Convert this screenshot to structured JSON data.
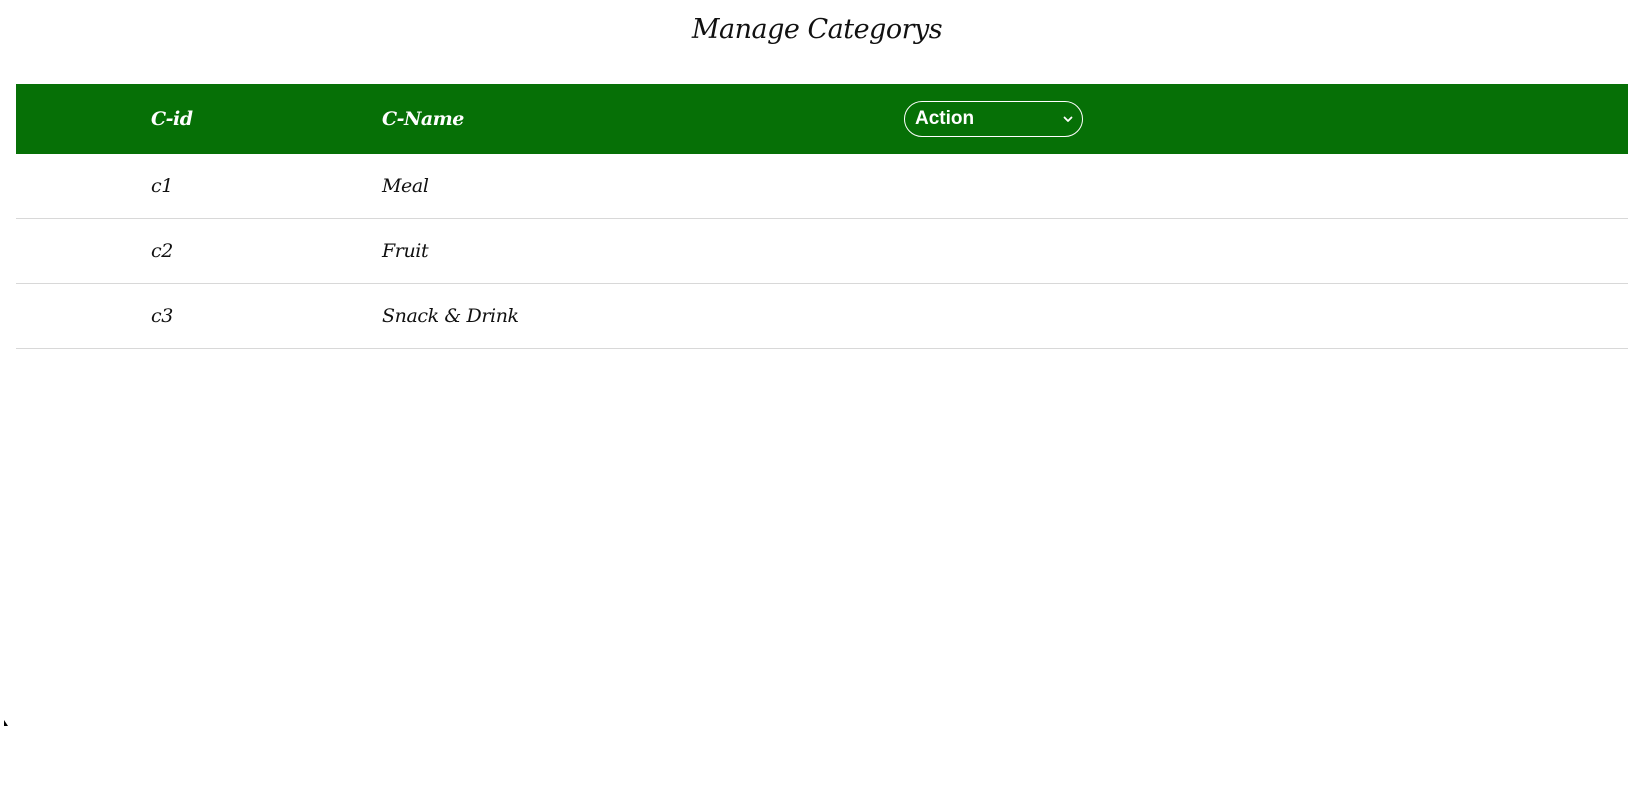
{
  "page": {
    "title": "Manage Categorys"
  },
  "table": {
    "headers": {
      "id": "C-id",
      "name": "C-Name",
      "action": "Action"
    },
    "rows": [
      {
        "id": "c1",
        "name": "Meal"
      },
      {
        "id": "c2",
        "name": "Fruit"
      },
      {
        "id": "c3",
        "name": "Snack & Drink"
      }
    ]
  },
  "colors": {
    "header_background": "#067006",
    "header_text": "#ffffff",
    "row_divider": "#d8d8d8"
  },
  "icons": {
    "action_select": "chevron-down-icon"
  }
}
